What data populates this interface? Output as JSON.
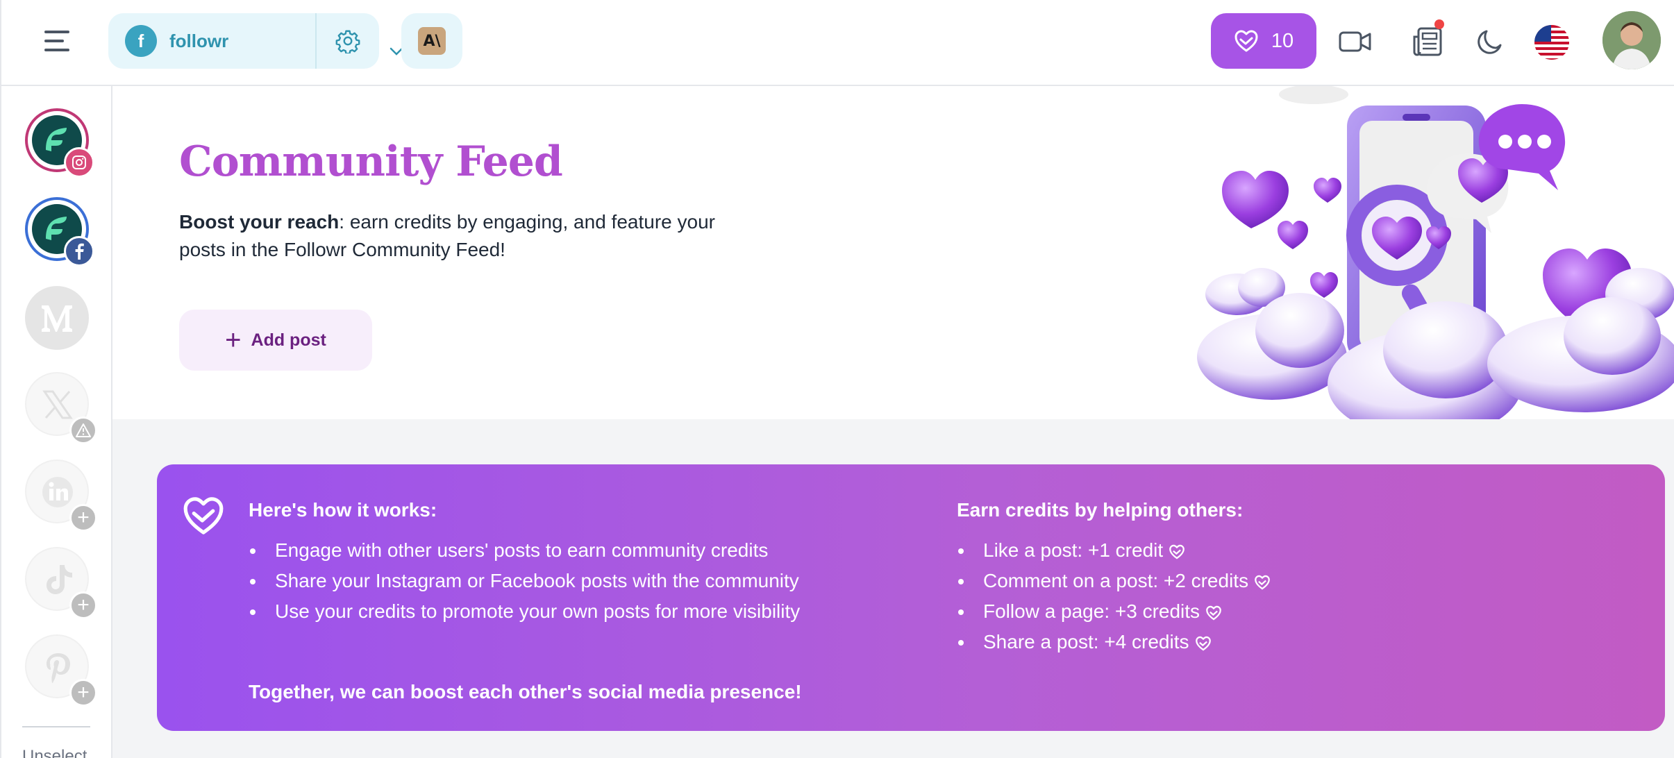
{
  "topbar": {
    "account": {
      "initial": "f",
      "name": "followr"
    },
    "anthropic_logo_text": "A\\",
    "credits": "10"
  },
  "sidebar": {
    "accounts": [
      {
        "network": "instagram",
        "state": "selected"
      },
      {
        "network": "facebook",
        "state": "selected"
      },
      {
        "network": "medium",
        "state": "inactive"
      },
      {
        "network": "x",
        "state": "warning"
      },
      {
        "network": "linkedin",
        "state": "add"
      },
      {
        "network": "tiktok",
        "state": "add"
      },
      {
        "network": "pinterest",
        "state": "add"
      }
    ],
    "unselect_label": "Unselect"
  },
  "hero": {
    "title": "Community Feed",
    "desc_bold": "Boost your reach",
    "desc_rest": ": earn credits by engaging, and feature your posts in the Followr Community Feed!",
    "add_post_label": "Add post"
  },
  "info": {
    "how_title": "Here's how it works:",
    "how_items": [
      "Engage with other users' posts to earn community credits",
      "Share your Instagram or Facebook posts with the community",
      "Use your credits to promote your own posts for more visibility"
    ],
    "earn_title": "Earn credits by helping others:",
    "earn_items": [
      "Like a post: +1 credit",
      "Comment on a post: +2 credits",
      "Follow a page: +3 credits",
      "Share a post: +4 credits"
    ],
    "footer": "Together, we can boost each other's social media presence!"
  },
  "colors": {
    "brand_purple": "#a754e6",
    "title_purple": "#b14fd0",
    "accent_teal": "#2f93ae",
    "instagram": "#c03875",
    "facebook": "#3b6fd6"
  },
  "icons": [
    "menu-icon",
    "chevron-down-icon",
    "gear-icon",
    "heart-hands-icon",
    "video-icon",
    "news-icon",
    "moon-icon",
    "us-flag-icon"
  ]
}
